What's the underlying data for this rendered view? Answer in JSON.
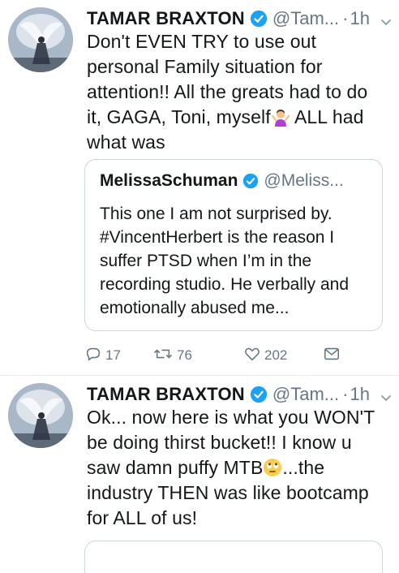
{
  "tweets": [
    {
      "author_name": "TAMAR BRAXTON",
      "handle": "@Tam...",
      "dot": "·",
      "time": "1h",
      "text_before_emoji": "Don't EVEN TRY to use out personal Family situation for attention!! All the greats had to do it, GAGA, Toni, myself",
      "emoji": "woman-shrugging",
      "text_after_emoji": " ALL had what was",
      "quote": {
        "author_name": "MelissaSchuman",
        "handle": "@Meliss...",
        "text": "This one I am not surprised by. #VincentHerbert is the reason I suffer PTSD when I’m in the recording studio. He verbally and emotionally abused me..."
      },
      "actions": {
        "reply_count": "17",
        "retweet_count": "76",
        "like_count": "202"
      }
    },
    {
      "author_name": "TAMAR BRAXTON",
      "handle": "@Tam...",
      "dot": "·",
      "time": "1h",
      "text_before_emoji": "Ok... now here is what you WON'T be doing thirst bucket!! I know u saw damn puffy MTB",
      "emoji": "face-with-rolling-eyes",
      "text_after_emoji": "...the industry THEN was like bootcamp for ALL of us!"
    }
  ],
  "icons": {
    "verified": "verified-badge-icon",
    "chevron": "chevron-down-icon",
    "reply": "reply-icon",
    "retweet": "retweet-icon",
    "like": "heart-icon",
    "dm": "envelope-icon"
  },
  "colors": {
    "verified_blue": "#1da1f2",
    "secondary_text": "#657786",
    "border": "#ccd6dd"
  }
}
